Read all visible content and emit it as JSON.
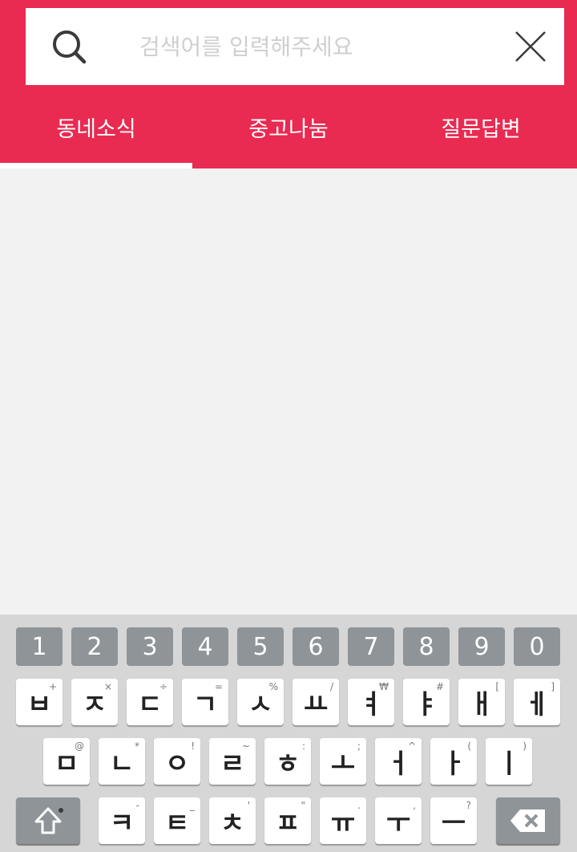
{
  "search": {
    "placeholder": "검색어를 입력해주세요",
    "value": ""
  },
  "tabs": [
    {
      "label": "동네소식",
      "active": true
    },
    {
      "label": "중고나눔",
      "active": false
    },
    {
      "label": "질문답변",
      "active": false
    }
  ],
  "keyboard": {
    "numbers": [
      "1",
      "2",
      "3",
      "4",
      "5",
      "6",
      "7",
      "8",
      "9",
      "0"
    ],
    "row1": [
      {
        "key": "ㅂ",
        "alt": "+"
      },
      {
        "key": "ㅈ",
        "alt": "×"
      },
      {
        "key": "ㄷ",
        "alt": "÷"
      },
      {
        "key": "ㄱ",
        "alt": "="
      },
      {
        "key": "ㅅ",
        "alt": "%"
      },
      {
        "key": "ㅛ",
        "alt": "/"
      },
      {
        "key": "ㅕ",
        "alt": "₩"
      },
      {
        "key": "ㅑ",
        "alt": "#"
      },
      {
        "key": "ㅐ",
        "alt": "["
      },
      {
        "key": "ㅔ",
        "alt": "]"
      }
    ],
    "row2": [
      {
        "key": "ㅁ",
        "alt": "@"
      },
      {
        "key": "ㄴ",
        "alt": "*"
      },
      {
        "key": "ㅇ",
        "alt": "!"
      },
      {
        "key": "ㄹ",
        "alt": "~"
      },
      {
        "key": "ㅎ",
        "alt": ":"
      },
      {
        "key": "ㅗ",
        "alt": ";"
      },
      {
        "key": "ㅓ",
        "alt": "^"
      },
      {
        "key": "ㅏ",
        "alt": "("
      },
      {
        "key": "ㅣ",
        "alt": ")"
      }
    ],
    "row3": [
      {
        "key": "ㅋ",
        "alt": "-"
      },
      {
        "key": "ㅌ",
        "alt": "_"
      },
      {
        "key": "ㅊ",
        "alt": "'"
      },
      {
        "key": "ㅍ",
        "alt": "\""
      },
      {
        "key": "ㅠ",
        "alt": "."
      },
      {
        "key": "ㅜ",
        "alt": ","
      },
      {
        "key": "ㅡ",
        "alt": "?"
      }
    ],
    "shift_icon": "shift-up-arrow-icon",
    "backspace_icon": "backspace-icon"
  },
  "colors": {
    "brand": "#e92a51",
    "content_bg": "#f2f2f2",
    "keyboard_bg": "#d6d6d6",
    "function_key": "#8e9497"
  }
}
